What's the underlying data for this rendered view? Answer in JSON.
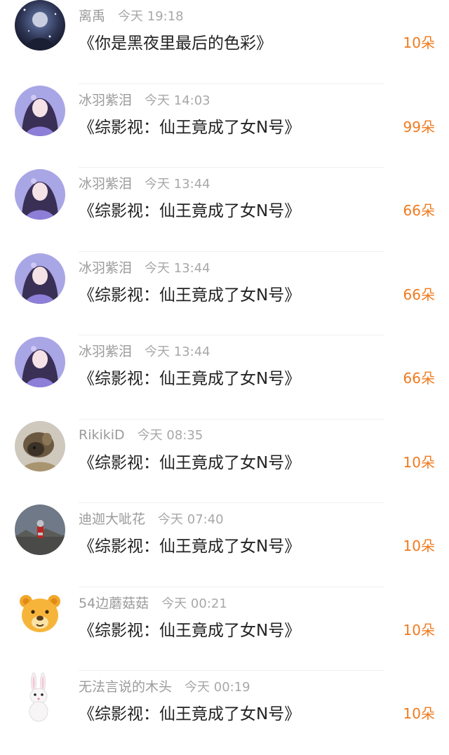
{
  "gifts": [
    {
      "user": "离禹",
      "time": "今天 19:18",
      "title": "《你是黑夜里最后的色彩》",
      "count": "10朵",
      "avatar_icon": "dark-starry-portrait"
    },
    {
      "user": "冰羽紫泪",
      "time": "今天 14:03",
      "title": "《综影视：仙王竟成了女N号》",
      "count": "99朵",
      "avatar_icon": "purple-anime-girl"
    },
    {
      "user": "冰羽紫泪",
      "time": "今天 13:44",
      "title": "《综影视：仙王竟成了女N号》",
      "count": "66朵",
      "avatar_icon": "purple-anime-girl"
    },
    {
      "user": "冰羽紫泪",
      "time": "今天 13:44",
      "title": "《综影视：仙王竟成了女N号》",
      "count": "66朵",
      "avatar_icon": "purple-anime-girl"
    },
    {
      "user": "冰羽紫泪",
      "time": "今天 13:44",
      "title": "《综影视：仙王竟成了女N号》",
      "count": "66朵",
      "avatar_icon": "purple-anime-girl"
    },
    {
      "user": "RikikiD",
      "time": "今天 08:35",
      "title": "《综影视：仙王竟成了女N号》",
      "count": "10朵",
      "avatar_icon": "dog-photo"
    },
    {
      "user": "迪迦大呲花",
      "time": "今天 07:40",
      "title": "《综影视：仙王竟成了女N号》",
      "count": "10朵",
      "avatar_icon": "ultraman-figure"
    },
    {
      "user": "54边蘑菇菇",
      "time": "今天 00:21",
      "title": "《综影视：仙王竟成了女N号》",
      "count": "10朵",
      "avatar_icon": "bear-face"
    },
    {
      "user": "无法言说的木头",
      "time": "今天 00:19",
      "title": "《综影视：仙王竟成了女N号》",
      "count": "10朵",
      "avatar_icon": "white-rabbit"
    }
  ],
  "colors": {
    "accent": "#f07a1e",
    "meta": "#9b9b9b",
    "title": "#222222"
  }
}
